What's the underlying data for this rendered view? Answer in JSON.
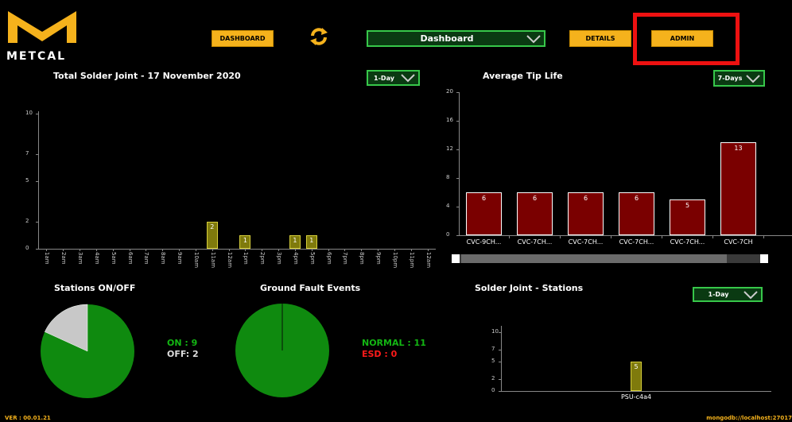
{
  "header": {
    "logo_text": "METCAL",
    "dashboard_button": "DASHBOARD",
    "dropdown_value": "Dashboard",
    "details_button": "DETAILS",
    "admin_button": "ADMIN"
  },
  "total_solder": {
    "title": "Total Solder Joint - 17 November 2020",
    "range": "1-Day",
    "chart_data": {
      "type": "bar",
      "categories": [
        "1am",
        "2am",
        "3am",
        "4am",
        "5am",
        "6am",
        "7am",
        "8am",
        "9am",
        "10am",
        "11am",
        "12am",
        "1pm",
        "2pm",
        "3pm",
        "4pm",
        "5pm",
        "6pm",
        "7pm",
        "8pm",
        "9pm",
        "10pm",
        "11pm",
        "12am"
      ],
      "values": [
        0,
        0,
        0,
        0,
        0,
        0,
        0,
        0,
        0,
        0,
        2,
        0,
        1,
        0,
        0,
        1,
        1,
        0,
        0,
        0,
        0,
        0,
        0,
        0
      ],
      "ylim": [
        0,
        10
      ],
      "yticks": [
        "10",
        "7",
        "5",
        "2",
        "0"
      ]
    }
  },
  "tip_life": {
    "title": "Average Tip Life",
    "range": "7-Days",
    "chart_data": {
      "type": "bar",
      "categories": [
        "CVC-9CH...",
        "CVC-7CH...",
        "CVC-7CH...",
        "CVC-7CH...",
        "CVC-7CH...",
        "CVC-7CH"
      ],
      "values": [
        6,
        6,
        6,
        6,
        5,
        13
      ],
      "ylim": [
        0,
        20
      ],
      "yticks": [
        "20",
        "16",
        "12",
        "8",
        "4",
        "0"
      ]
    }
  },
  "stations": {
    "title": "Stations ON/OFF",
    "on_label": "ON : 9",
    "off_label": "OFF: 2",
    "chart_data": {
      "type": "pie",
      "labels": [
        "ON",
        "OFF"
      ],
      "values": [
        9,
        2
      ]
    },
    "colors": {
      "on": "#0f8a0f",
      "off": "#c8c8c8"
    }
  },
  "ground_fault": {
    "title": "Ground Fault Events",
    "normal_label": "NORMAL : 11",
    "esd_label": "ESD : 0",
    "chart_data": {
      "type": "pie",
      "labels": [
        "NORMAL",
        "ESD"
      ],
      "values": [
        11,
        0
      ]
    }
  },
  "solder_stations": {
    "title": "Solder Joint - Stations",
    "range": "1-Day",
    "chart_data": {
      "type": "bar",
      "categories": [
        "PSU-c4a4"
      ],
      "values": [
        5
      ],
      "ylim": [
        0,
        10
      ],
      "yticks": [
        "10",
        "7",
        "5",
        "2",
        "0"
      ]
    }
  },
  "footer": {
    "version": "VER : 00.01.21",
    "db": "mongodb://localhost:27017"
  }
}
